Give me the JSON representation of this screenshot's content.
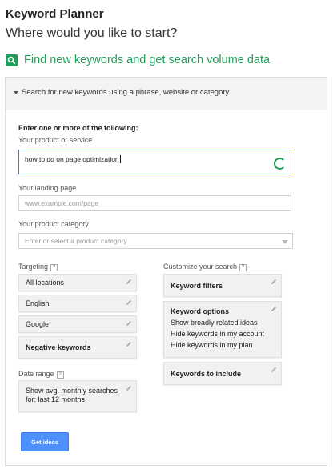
{
  "header": {
    "title": "Keyword Planner",
    "subtitle": "Where would you like to start?"
  },
  "section": {
    "icon": "search-icon",
    "title": "Find new keywords and get search volume data",
    "color": "#1e9d57"
  },
  "panel": {
    "header_label": "Search for new keywords using a phrase, website or category",
    "intro": "Enter one or more of the following:",
    "product": {
      "label": "Your product or service",
      "value": "how to do on page optimization"
    },
    "landing": {
      "label": "Your landing page",
      "placeholder": "www.example.com/page"
    },
    "category": {
      "label": "Your product category",
      "placeholder": "Enter or select a product category"
    },
    "targeting": {
      "label": "Targeting",
      "help": "?",
      "location": "All locations",
      "language": "English",
      "network": "Google",
      "negative": "Negative keywords"
    },
    "date_range": {
      "label": "Date range",
      "help": "?",
      "line1": "Show avg. monthly searches",
      "line2": "for: last 12 months"
    },
    "customize": {
      "label": "Customize your search",
      "help": "?",
      "filters": "Keyword filters",
      "options": {
        "title": "Keyword options",
        "line1": "Show broadly related ideas",
        "line2": "Hide keywords in my account",
        "line3": "Hide keywords in my plan"
      },
      "include": "Keywords to include"
    },
    "button_label": "Get ideas",
    "accent": "#4d90fe"
  }
}
